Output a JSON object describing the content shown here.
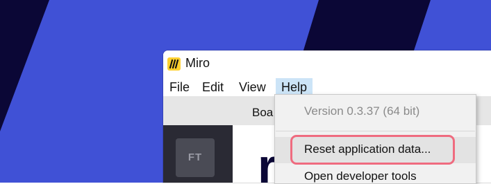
{
  "window": {
    "title": "Miro",
    "logo_icon": "miro-logo-icon"
  },
  "menubar": {
    "items": [
      "File",
      "Edit",
      "View",
      "Help"
    ],
    "active": "Help"
  },
  "toolbar": {
    "text": "Boa"
  },
  "sidebar": {
    "avatar_initials": "FT"
  },
  "main": {
    "big_letter": "r"
  },
  "help_menu": {
    "version": "Version 0.3.37 (64 bit)",
    "reset": "Reset application data...",
    "devtools": "Open developer tools"
  },
  "colors": {
    "background": "#0b0736",
    "stripe": "#4051d6",
    "highlight_border": "#ef6b7f",
    "menu_active": "#cce4f7",
    "logo": "#ffd02f"
  }
}
